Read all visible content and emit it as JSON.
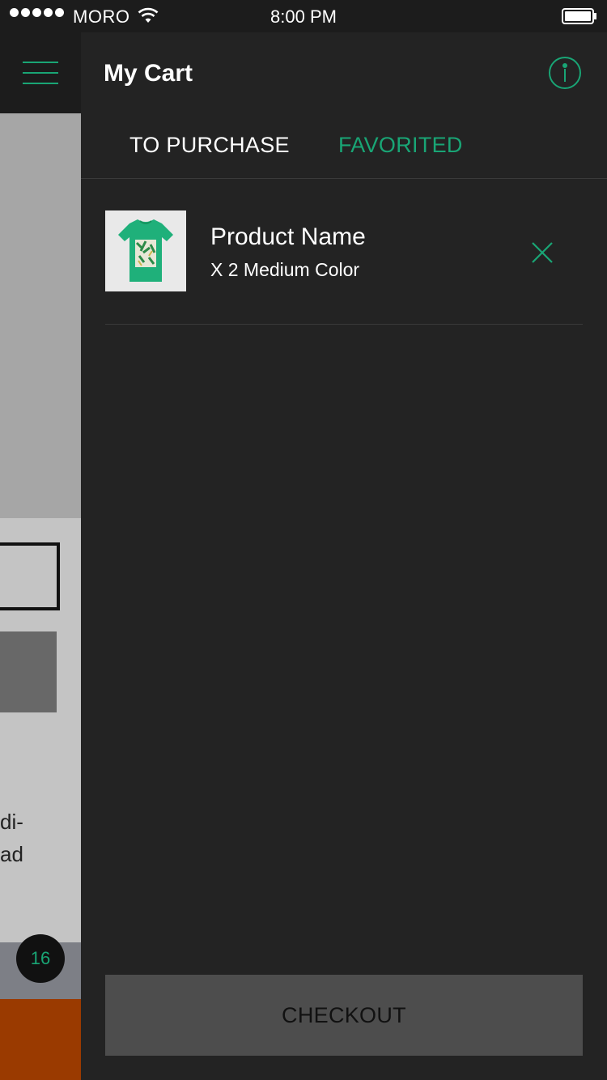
{
  "status_bar": {
    "carrier": "MORO",
    "time": "8:00 PM"
  },
  "underlying_page": {
    "text_lines": [
      "di-",
      "ad"
    ],
    "badge_count": "16"
  },
  "cart": {
    "title": "My Cart",
    "tabs": [
      {
        "label": "TO PURCHASE",
        "active": false
      },
      {
        "label": "FAVORITED",
        "active": true
      }
    ],
    "items": [
      {
        "name": "Product Name",
        "details": "X 2 Medium Color"
      }
    ],
    "checkout_label": "CHECKOUT"
  },
  "colors": {
    "accent": "#19a575",
    "panel_bg": "#232323",
    "button_bg": "#4d4d4d"
  }
}
